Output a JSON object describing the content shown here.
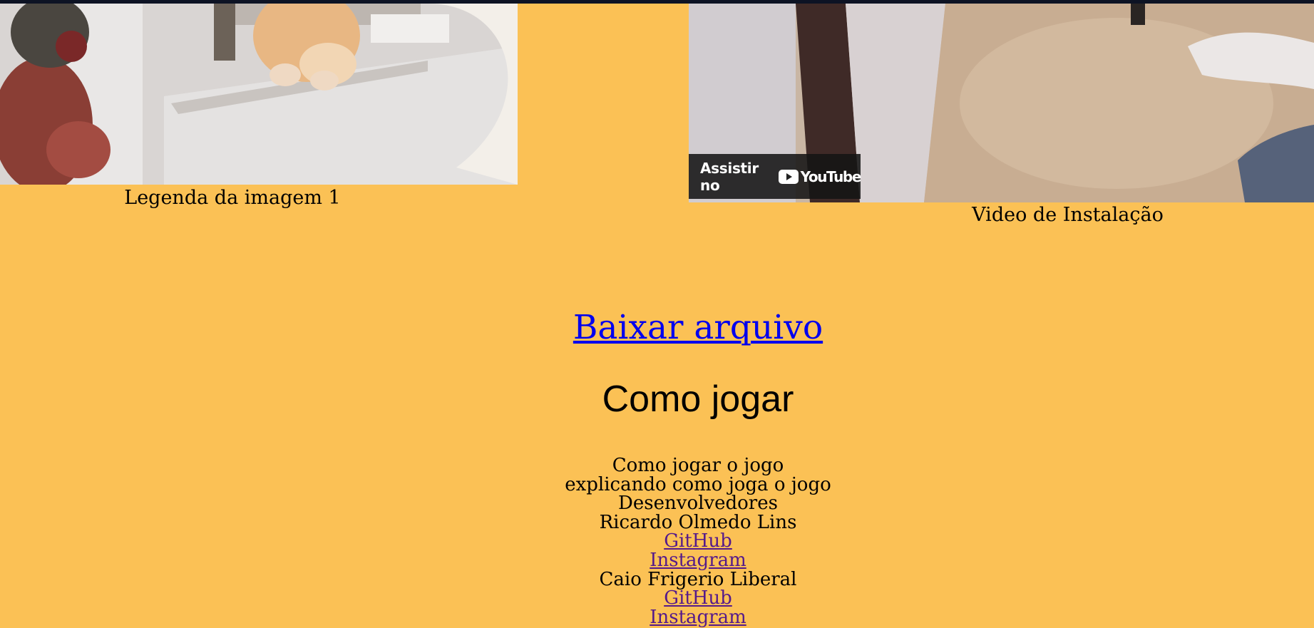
{
  "image1": {
    "caption": "Legenda da imagem 1"
  },
  "video": {
    "watch_on": "Assistir no",
    "brand": "YouTube",
    "caption": "Video de Instalação"
  },
  "download": {
    "label": "Baixar arquivo"
  },
  "how_to_play": {
    "title": "Como jogar",
    "subtitle": "Como jogar o jogo",
    "description": "explicando como joga o jogo"
  },
  "developers": {
    "heading": "Desenvolvedores",
    "people": [
      {
        "name": "Ricardo Olmedo Lins",
        "github": "GitHub",
        "instagram": "Instagram"
      },
      {
        "name": "Caio Frigerio Liberal",
        "github": "GitHub",
        "instagram": "Instagram"
      }
    ]
  },
  "colors": {
    "background": "#fbc155",
    "link": "#0000ee",
    "visited_link": "#551a8b",
    "top_bar": "#0d1324"
  }
}
